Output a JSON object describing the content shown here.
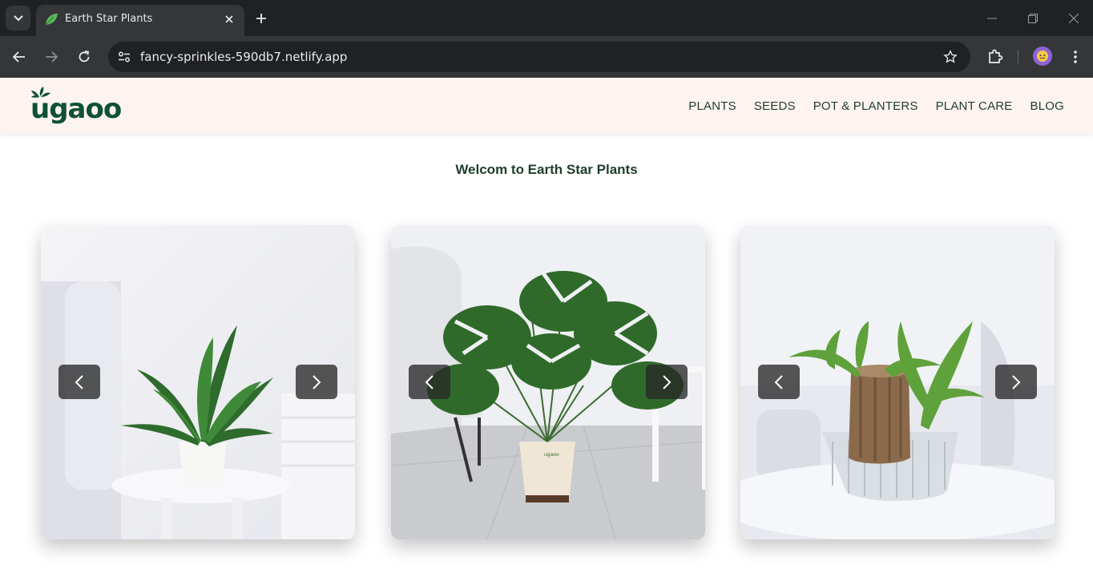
{
  "browser": {
    "tab_title": "Earth Star Plants",
    "url": "fancy-sprinkles-590db7.netlify.app"
  },
  "site": {
    "logo_text": "ugaoo",
    "nav": [
      "PLANTS",
      "SEEDS",
      "POT & PLANTERS",
      "PLANT CARE",
      "BLOG"
    ],
    "welcome": "Welcom to Earth Star Plants",
    "brand_color": "#0f5132",
    "header_bg": "#fdf3f1"
  },
  "carousels": [
    {
      "image": "peace-lily-in-white-pot-on-side-table"
    },
    {
      "image": "monstera-in-cream-ugaoo-pot"
    },
    {
      "image": "lucky-bamboo-stump-in-glass-bowl"
    }
  ],
  "icons": {
    "prev": "chevron-left-icon",
    "next": "chevron-right-icon"
  }
}
